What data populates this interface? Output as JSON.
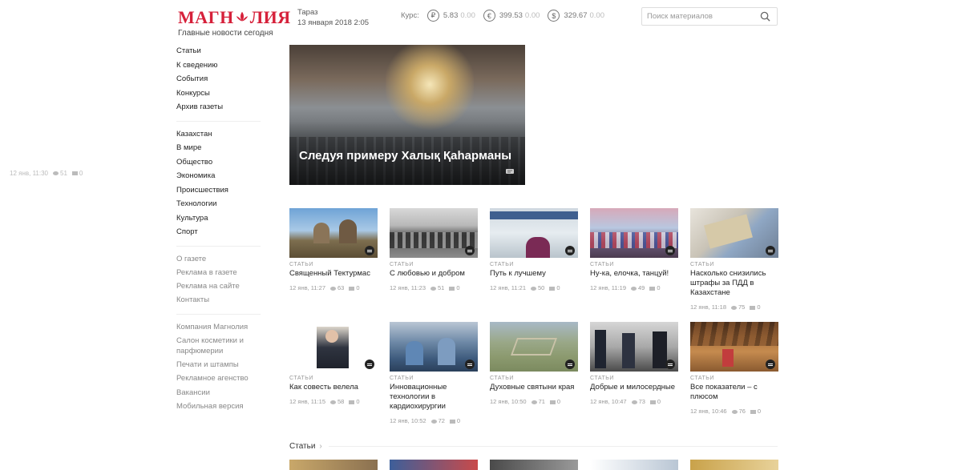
{
  "logo": {
    "word_left": "МАГН",
    "word_right": "ЛИЯ",
    "tagline": "Главные новости сегодня"
  },
  "header": {
    "city": "Тараз",
    "datetime": "13 января 2018 2:05",
    "rates_label": "Курс:",
    "rates": [
      {
        "symbol": "₽",
        "icon": "ruble-icon",
        "value": "5.83",
        "change": "0.00"
      },
      {
        "symbol": "€",
        "icon": "euro-icon",
        "value": "399.53",
        "change": "0.00"
      },
      {
        "symbol": "$",
        "icon": "dollar-icon",
        "value": "329.67",
        "change": "0.00"
      }
    ],
    "search_placeholder": "Поиск материалов"
  },
  "sidebar": {
    "group1": [
      "Статьи",
      "К сведению",
      "События",
      "Конкурсы",
      "Архив газеты"
    ],
    "group2": [
      "Казахстан",
      "В мире",
      "Общество",
      "Экономика",
      "Происшествия",
      "Технологии",
      "Культура",
      "Спорт"
    ],
    "group3": [
      "О газете",
      "Реклама в газете",
      "Реклама на сайте",
      "Контакты"
    ],
    "group4": [
      "Компания Магнолия",
      "Салон косметики и парфюмерии",
      "Печати и штампы",
      "Рекламное агенство",
      "Вакансии",
      "Мобильная версия"
    ]
  },
  "hero": {
    "title": "Следуя примеру Халық Қаһарманы",
    "date": "12 янв, 11:30",
    "views": "51",
    "comments": "0"
  },
  "cards_row1": [
    {
      "category": "СТАТЬИ",
      "title": "Священный Тектурмас",
      "date": "12 янв, 11:27",
      "views": "63",
      "comments": "0"
    },
    {
      "category": "СТАТЬИ",
      "title": "С любовью и добром",
      "date": "12 янв, 11:23",
      "views": "51",
      "comments": "0"
    },
    {
      "category": "СТАТЬИ",
      "title": "Путь к лучшему",
      "date": "12 янв, 11:21",
      "views": "50",
      "comments": "0"
    },
    {
      "category": "СТАТЬИ",
      "title": "Ну-ка, елочка, танцуй!",
      "date": "12 янв, 11:19",
      "views": "49",
      "comments": "0"
    },
    {
      "category": "СТАТЬИ",
      "title": "Насколько снизились штрафы за ПДД в Казахстане",
      "date": "12 янв, 11:18",
      "views": "75",
      "comments": "0"
    }
  ],
  "cards_row2": [
    {
      "category": "СТАТЬИ",
      "title": "Как совесть велела",
      "date": "12 янв, 11:15",
      "views": "58",
      "comments": "0"
    },
    {
      "category": "СТАТЬИ",
      "title": "Инновационные технологии в кардиохирургии",
      "date": "12 янв, 10:52",
      "views": "72",
      "comments": "0"
    },
    {
      "category": "СТАТЬИ",
      "title": "Духовные святыни края",
      "date": "12 янв, 10:50",
      "views": "71",
      "comments": "0"
    },
    {
      "category": "СТАТЬИ",
      "title": "Добрые и милосердные",
      "date": "12 янв, 10:47",
      "views": "73",
      "comments": "0"
    },
    {
      "category": "СТАТЬИ",
      "title": "Все показатели – с плюсом",
      "date": "12 янв, 10:46",
      "views": "76",
      "comments": "0"
    }
  ],
  "section": {
    "title": "Статьи"
  },
  "colors": {
    "brand": "#d6203a",
    "text": "#222222",
    "muted": "#888888"
  }
}
